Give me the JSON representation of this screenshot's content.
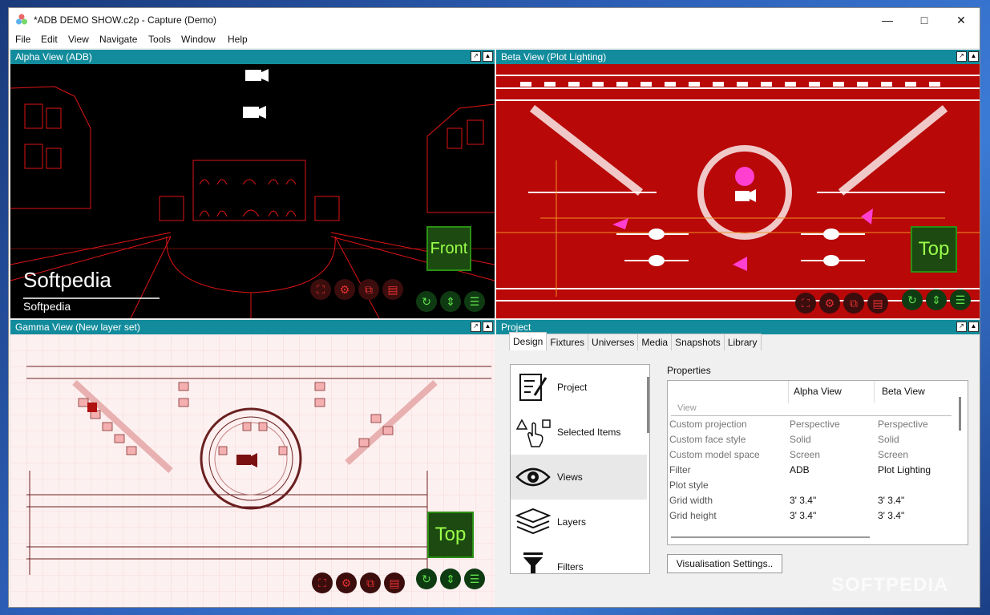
{
  "window": {
    "title": "*ADB DEMO SHOW.c2p - Capture (Demo)"
  },
  "menu": [
    "File",
    "Edit",
    "View",
    "Navigate",
    "Tools",
    "Window",
    "Help"
  ],
  "panels": {
    "alpha": {
      "title": "Alpha View  (ADB)",
      "badge": "Front",
      "watermark_big": "Softpedia",
      "watermark_small": "Softpedia"
    },
    "beta": {
      "title": "Beta View  (Plot Lighting)",
      "badge": "Top"
    },
    "gamma": {
      "title": "Gamma View  (New layer set)",
      "badge": "Top"
    },
    "project": {
      "title": "Project"
    }
  },
  "project": {
    "tabs": [
      "Design",
      "Fixtures",
      "Universes",
      "Media",
      "Snapshots",
      "Library"
    ],
    "nav_items": [
      "Project",
      "Selected Items",
      "Views",
      "Layers",
      "Filters"
    ],
    "properties_label": "Properties",
    "columns": [
      "Alpha View",
      "Beta View"
    ],
    "section": "View",
    "rows": [
      {
        "name": "Custom projection",
        "alpha": "Perspective",
        "beta": "Perspective",
        "dim": true
      },
      {
        "name": "Custom face style",
        "alpha": "Solid",
        "beta": "Solid",
        "dim": true
      },
      {
        "name": "Custom model space",
        "alpha": "Screen",
        "beta": "Screen",
        "dim": true
      },
      {
        "name": "Filter",
        "alpha": "ADB",
        "beta": "Plot Lighting",
        "dim": false
      },
      {
        "name": "Plot style",
        "alpha": "",
        "beta": "",
        "dim": false
      },
      {
        "name": "Grid width",
        "alpha": "3' 3.4\"",
        "beta": "3' 3.4\"",
        "dim": false
      },
      {
        "name": "Grid height",
        "alpha": "3' 3.4\"",
        "beta": "3' 3.4\"",
        "dim": false
      }
    ],
    "vis_button": "Visualisation Settings.."
  },
  "watermark": "SOFTPEDIA"
}
